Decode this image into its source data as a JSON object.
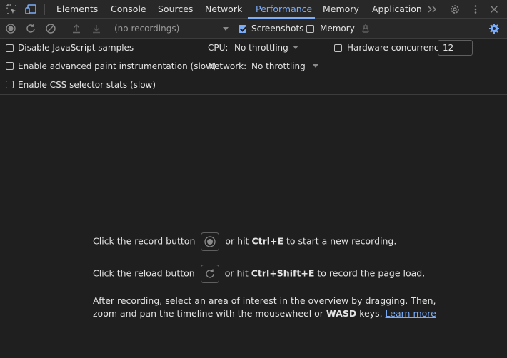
{
  "tabs": {
    "items": [
      {
        "label": "Elements"
      },
      {
        "label": "Console"
      },
      {
        "label": "Sources"
      },
      {
        "label": "Network"
      },
      {
        "label": "Performance"
      },
      {
        "label": "Memory"
      },
      {
        "label": "Application"
      }
    ],
    "active": "Performance",
    "overflow_icon": "chevron-double-right-icon",
    "settings_icon": "gear-icon",
    "more_icon": "kebab-menu-icon",
    "close_icon": "close-icon"
  },
  "toolbar": {
    "recording_select": "(no recordings)",
    "screenshots_label": "Screenshots",
    "screenshots_checked": true,
    "memory_label": "Memory",
    "memory_checked": false,
    "icons": [
      "record-icon",
      "reload-record-icon",
      "clear-icon",
      "upload-icon",
      "download-icon",
      "garbage-collect-icon",
      "capture-settings-gear-icon"
    ]
  },
  "settings": {
    "disable_js_samples": "Disable JavaScript samples",
    "advanced_paint": "Enable advanced paint instrumentation (slow)",
    "css_selector_stats": "Enable CSS selector stats (slow)",
    "cpu_label": "CPU:",
    "cpu_value": "No throttling",
    "network_label": "Network:",
    "network_value": "No throttling",
    "hardware_concurrency_label": "Hardware concurrency",
    "hardware_concurrency_value": "12"
  },
  "landing": {
    "record_pre": "Click the record button",
    "record_mid": "or hit",
    "record_key": "Ctrl+E",
    "record_post": "to start a new recording.",
    "reload_pre": "Click the reload button",
    "reload_mid": "or hit",
    "reload_key": "Ctrl+Shift+E",
    "reload_post": "to record the page load.",
    "after_line1": "After recording, select an area of interest in the overview by dragging. Then,",
    "after_line2_pre": "zoom and pan the timeline with the mousewheel or",
    "after_line2_key": "WASD",
    "after_line2_post": "keys.",
    "learn_more": "Learn more"
  },
  "colors": {
    "accent": "#7cacf8",
    "background": "#1f1f1f",
    "toolbar": "#282828"
  }
}
